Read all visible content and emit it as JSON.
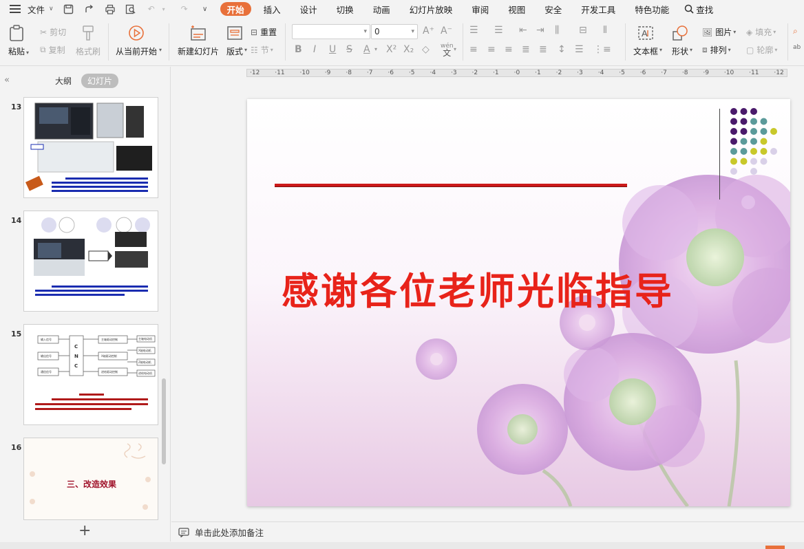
{
  "menubar": {
    "file_label": "文件",
    "tabs": [
      {
        "label": "开始",
        "active": true
      },
      {
        "label": "插入"
      },
      {
        "label": "设计"
      },
      {
        "label": "切换"
      },
      {
        "label": "动画"
      },
      {
        "label": "幻灯片放映"
      },
      {
        "label": "审阅"
      },
      {
        "label": "视图"
      },
      {
        "label": "安全"
      },
      {
        "label": "开发工具"
      },
      {
        "label": "特色功能"
      }
    ],
    "search_label": "查找"
  },
  "ribbon": {
    "paste": "粘贴",
    "cut": "剪切",
    "copy": "复制",
    "format_painter": "格式刷",
    "from_current": "从当前开始",
    "new_slide": "新建幻灯片",
    "layout": "版式",
    "reset": "重置",
    "section": "节",
    "font_size": "0",
    "text_box": "文本框",
    "shape": "形状",
    "picture": "图片",
    "fill": "填充",
    "arrange": "排列",
    "outline": "轮廓",
    "wen_label": "wén",
    "wen_char": "文"
  },
  "leftpanel": {
    "outline_tab": "大纲",
    "slides_tab": "幻灯片",
    "slides": [
      {
        "number": "13"
      },
      {
        "number": "14"
      },
      {
        "number": "15"
      },
      {
        "number": "16",
        "title": "三、改造效果"
      }
    ],
    "slide15": {
      "boxes_left": [
        "输入信号",
        "输出信号",
        "通信信号"
      ],
      "cnc": [
        "C",
        "N",
        "C"
      ],
      "boxes_mid": [
        "主轴驱动控制",
        "X轴驱动控制",
        "进给驱动控制"
      ],
      "boxes_right": [
        "主轴电动机",
        "X轴电动机",
        "Z轴电动机",
        "进给电动机"
      ]
    }
  },
  "ruler": {
    "ticks": [
      "12",
      "11",
      "10",
      "9",
      "8",
      "7",
      "6",
      "5",
      "4",
      "3",
      "2",
      "1",
      "0",
      "1",
      "2",
      "3",
      "4",
      "5",
      "6",
      "7",
      "8",
      "9",
      "10",
      "11",
      "12"
    ]
  },
  "slide": {
    "title": "感谢各位老师光临指导"
  },
  "notes": {
    "placeholder": "单击此处添加备注"
  },
  "colors": {
    "accent": "#e8703a",
    "title_red": "#e8231a",
    "dot_purple": "#4a1a6b",
    "dot_teal": "#5b9a9a",
    "dot_yellow": "#c8c82a",
    "dot_lavender": "#d9d0e8"
  }
}
